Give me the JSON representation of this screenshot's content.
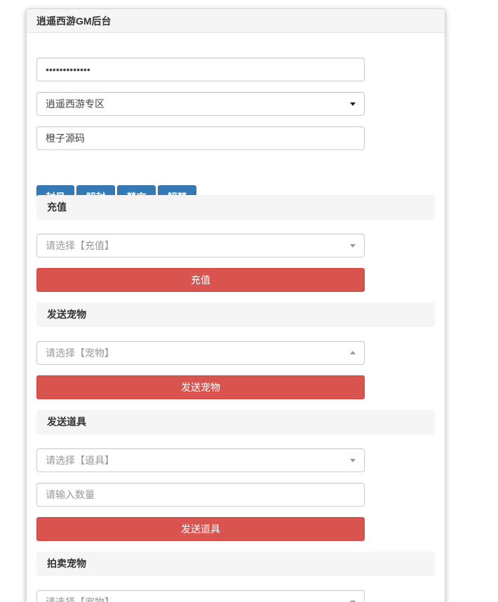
{
  "title": "逍遥西游GM后台",
  "password": {
    "value": "•••••••••••••"
  },
  "server": {
    "selected": "逍遥西游专区"
  },
  "role": {
    "value": "橙子源码"
  },
  "actions": {
    "ban": "封号",
    "unban": "解封",
    "mute": "禁言",
    "unmute": "解禁"
  },
  "recharge": {
    "section": "充值",
    "select_placeholder": "请选择【充值】",
    "button": "充值"
  },
  "pet": {
    "section": "发送宠物",
    "select_placeholder": "请选择【宠物】",
    "button": "发送宠物"
  },
  "item": {
    "section": "发送道具",
    "select_placeholder": "请选择【道具】",
    "quantity_placeholder": "请输入数量",
    "button": "发送道具"
  },
  "auction": {
    "section": "拍卖宠物",
    "select_placeholder": "请选择【宠物】"
  }
}
